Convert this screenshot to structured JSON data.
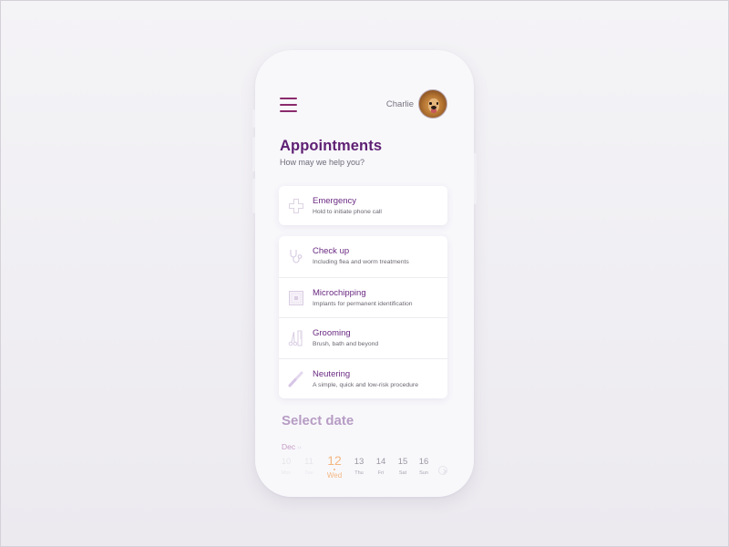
{
  "header": {
    "user_name": "Charlie",
    "avatar_alt": "dog-avatar"
  },
  "page": {
    "title": "Appointments",
    "subtitle": "How may we help you?"
  },
  "emergency": {
    "title": "Emergency",
    "subtitle": "Hold to initiate phone call",
    "icon": "plus-cross-icon"
  },
  "services": [
    {
      "title": "Check up",
      "subtitle": "Including flea and worm treatments",
      "icon": "stethoscope-icon"
    },
    {
      "title": "Microchipping",
      "subtitle": "Implants for permanent identification",
      "icon": "microchip-icon"
    },
    {
      "title": "Grooming",
      "subtitle": "Brush, bath and beyond",
      "icon": "scissors-comb-icon"
    },
    {
      "title": "Neutering",
      "subtitle": "A simple, quick and low-risk procedure",
      "icon": "scalpel-icon"
    }
  ],
  "date_picker": {
    "heading": "Select date",
    "month": "Dec",
    "month_arrow": "››",
    "selected_day": "12",
    "days": [
      {
        "num": "10",
        "dow": "Mon",
        "state": "past"
      },
      {
        "num": "11",
        "dow": "Tue",
        "state": "past"
      },
      {
        "num": "12",
        "dow": "Wed",
        "state": "selected"
      },
      {
        "num": "13",
        "dow": "Thu",
        "state": "future"
      },
      {
        "num": "14",
        "dow": "Fri",
        "state": "future"
      },
      {
        "num": "15",
        "dow": "Sat",
        "state": "future"
      },
      {
        "num": "16",
        "dow": "Sun",
        "state": "future"
      }
    ]
  },
  "colors": {
    "primary": "#5e1f73",
    "menu_accent": "#8a2a6b",
    "selected_date": "#f3b782",
    "heading_muted": "#b79cc4"
  }
}
